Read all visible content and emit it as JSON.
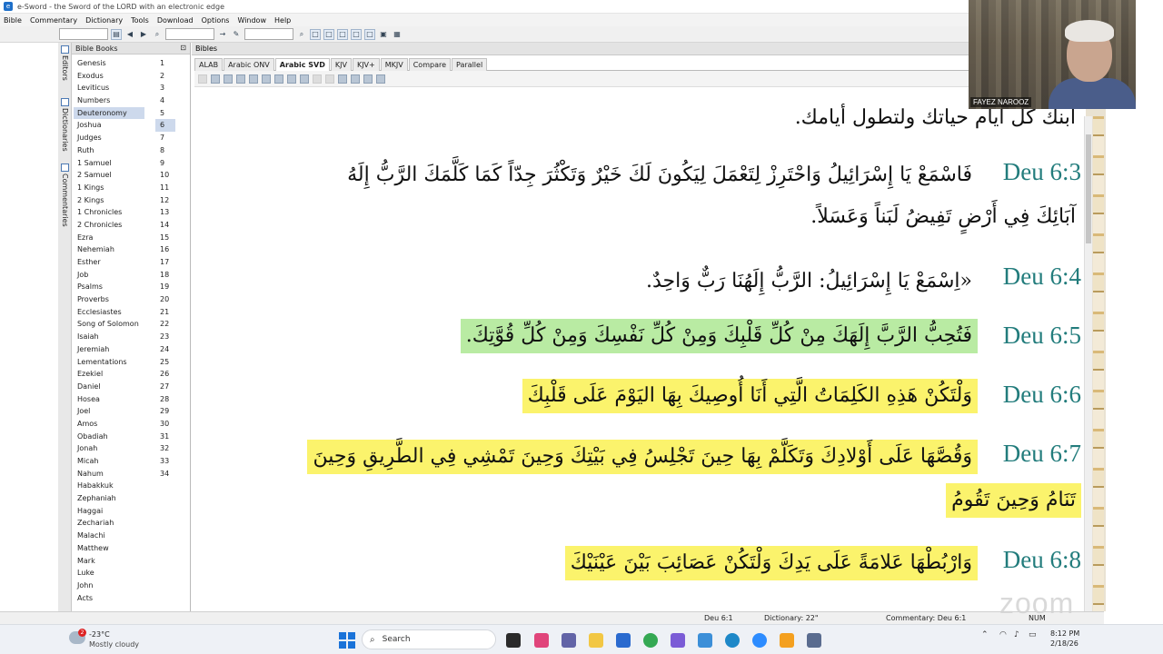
{
  "window": {
    "title": "e-Sword - the Sword of the LORD with an electronic edge"
  },
  "menu": [
    "Bible",
    "Commentary",
    "Dictionary",
    "Tools",
    "Download",
    "Options",
    "Window",
    "Help"
  ],
  "sidebar_tabs": [
    "Editors",
    "Dictionaries",
    "Commentaries"
  ],
  "books_panel": {
    "title": "Bible Books",
    "books": [
      "Genesis",
      "Exodus",
      "Leviticus",
      "Numbers",
      "Deuteronomy",
      "Joshua",
      "Judges",
      "Ruth",
      "1 Samuel",
      "2 Samuel",
      "1 Kings",
      "2 Kings",
      "1 Chronicles",
      "2 Chronicles",
      "Ezra",
      "Nehemiah",
      "Esther",
      "Job",
      "Psalms",
      "Proverbs",
      "Ecclesiastes",
      "Song of Solomon",
      "Isaiah",
      "Jeremiah",
      "Lementations",
      "Ezekiel",
      "Daniel",
      "Hosea",
      "Joel",
      "Amos",
      "Obadiah",
      "Jonah",
      "Micah",
      "Nahum",
      "Habakkuk",
      "Zephaniah",
      "Haggai",
      "Zechariah",
      "Malachi",
      "Matthew",
      "Mark",
      "Luke",
      "John",
      "Acts"
    ],
    "selected_book": "Deuteronomy",
    "chapters": [
      "1",
      "2",
      "3",
      "4",
      "5",
      "6",
      "7",
      "8",
      "9",
      "10",
      "11",
      "12",
      "13",
      "14",
      "15",
      "16",
      "17",
      "18",
      "19",
      "20",
      "21",
      "22",
      "23",
      "24",
      "25",
      "26",
      "27",
      "28",
      "29",
      "30",
      "31",
      "32",
      "33",
      "34"
    ],
    "selected_chapter": "6"
  },
  "bibles_panel": {
    "title": "Bibles",
    "tabs": [
      "ALAB",
      "Arabic ONV",
      "Arabic SVD",
      "KJV",
      "KJV+",
      "MKJV",
      "Compare",
      "Parallel"
    ],
    "active_tab": "Arabic SVD"
  },
  "verses": [
    {
      "ref": "",
      "lines": [
        "ابنك كل أيام حياتك ولتطول أيامك."
      ],
      "highlight": "none"
    },
    {
      "ref": "Deu 6:3",
      "lines": [
        "فَاسْمَعْ يَا إِسْرَائِيلُ وَاحْتَرِزْ لِتَعْمَلَ لِيَكُونَ لَكَ خَيْرٌ وَتَكْثُرَ جِدّاً كَمَا كَلَّمَكَ الرَّبُّ إِلَهُ",
        "آبَائِكَ فِي أَرْضٍ تَفِيضُ لَبَناً وَعَسَلاً."
      ],
      "highlight": "none"
    },
    {
      "ref": "Deu 6:4",
      "lines": [
        "«اِسْمَعْ يَا إِسْرَائِيلُ: الرَّبُّ إِلَهُنَا رَبٌّ وَاحِدٌ."
      ],
      "highlight": "none"
    },
    {
      "ref": "Deu 6:5",
      "lines": [
        "فَتُحِبُّ الرَّبَّ إِلَهَكَ مِنْ كُلِّ قَلْبِكَ وَمِنْ كُلِّ نَفْسِكَ وَمِنْ كُلِّ قُوَّتِكَ."
      ],
      "highlight": "green"
    },
    {
      "ref": "Deu 6:6",
      "lines": [
        "وَلْتَكُنْ هَذِهِ الكَلِمَاتُ الَّتِي أَنَا أُوصِيكَ بِهَا اليَوْمَ عَلَى قَلْبِكَ"
      ],
      "highlight": "yellow"
    },
    {
      "ref": "Deu 6:7",
      "lines": [
        "وَقُصَّهَا عَلَى أَوْلادِكَ وَتَكَلَّمْ بِهَا حِينَ تَجْلِسُ فِي بَيْتِكَ وَحِينَ تَمْشِي فِي الطَّرِيقِ وَحِينَ",
        "تَنَامُ وَحِينَ تَقُومُ"
      ],
      "highlight": "yellow"
    },
    {
      "ref": "Deu 6:8",
      "lines": [
        "وَارْبُطْهَا عَلامَةً عَلَى يَدِكَ وَلْتَكُنْ عَصَائِبَ بَيْنَ عَيْنَيْكَ"
      ],
      "highlight": "yellow"
    }
  ],
  "webcam": {
    "name": "FAYEZ NAROOZ"
  },
  "status_bar": {
    "verse": "Deu 6:1",
    "dictionary": "Dictionary: 22\"",
    "commentary": "Commentary: Deu 6:1",
    "num": "NUM"
  },
  "watermark": "zoom",
  "taskbar": {
    "weather_badge": "2",
    "temperature": "-23°C",
    "weather": "Mostly cloudy",
    "search_placeholder": "Search",
    "time": "8:12 PM",
    "date": "2/18/26"
  },
  "colors": {
    "verse_ref": "#227c7c",
    "highlight_green": "#b9eba3",
    "highlight_yellow": "#fbf36c"
  }
}
